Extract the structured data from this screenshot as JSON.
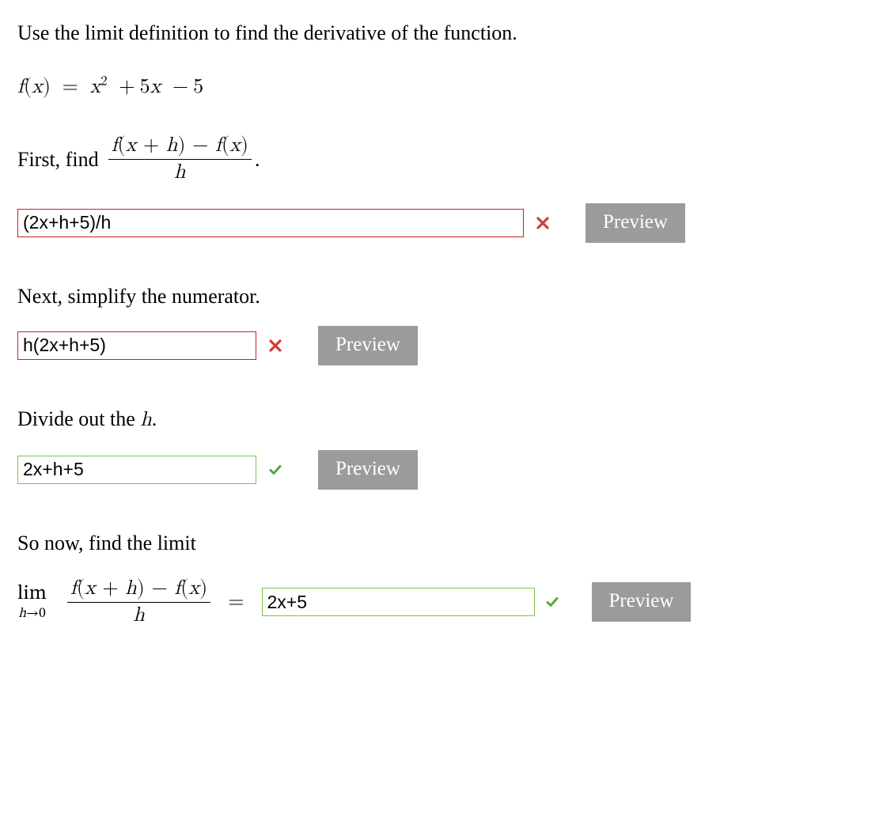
{
  "intro": "Use the limit definition to find the derivative of the function.",
  "function_def": {
    "lhs_f": "f",
    "lhs_var": "x",
    "eq": "=",
    "term_a_var": "x",
    "term_a_exp": "2",
    "plus1": "+",
    "term_b_coeff": "5",
    "term_b_var": "x",
    "minus": "−",
    "term_c": "5"
  },
  "step1": {
    "prefix": "First, find",
    "frac_num_text": "f(x + h) − f(x)",
    "frac_den_var": "h",
    "suffix": "."
  },
  "inputs": {
    "q1_value": "(2x+h+5)/h",
    "q2_value": "h(2x+h+5)",
    "q3_value": "2x+h+5",
    "q4_value": "2x+5"
  },
  "validation": {
    "q1": "wrong",
    "q2": "wrong",
    "q3": "right",
    "q4": "right"
  },
  "labels": {
    "preview": "Preview"
  },
  "step2": {
    "text": "Next, simplify the numerator."
  },
  "step3": {
    "prefix": "Divide out the ",
    "var": "h",
    "suffix": "."
  },
  "step4": {
    "text": "So now, find the limit"
  },
  "limit": {
    "word": "lim",
    "sub_var": "h",
    "arrow": "→",
    "sub_val": "0",
    "eq": "="
  }
}
